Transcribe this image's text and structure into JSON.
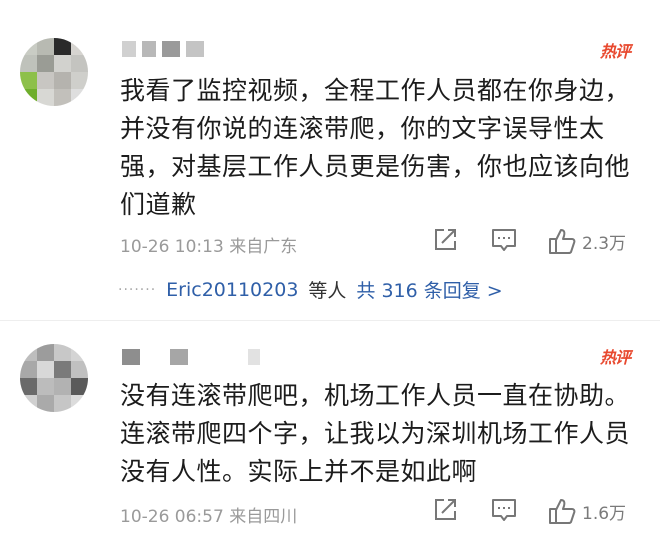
{
  "comments": [
    {
      "hot_badge": "热评",
      "text_lines": [
        "我看了监控视频，全程工作人员都在你身边，",
        "并没有你说的连滚带爬，你的文字误导性太",
        "强，对基层工作人员更是伤害，你也应该向他",
        "们道歉"
      ],
      "timestamp": "10-26 10:13",
      "location": "来自广东",
      "likes": "2.3万",
      "replies": {
        "dots": "·······",
        "user": "Eric20110203",
        "suffix": "等人",
        "count_text": "共 316 条回复 >"
      }
    },
    {
      "hot_badge": "热评",
      "text_lines": [
        "没有连滚带爬吧，机场工作人员一直在协助。",
        "连滚带爬四个字，让我以为深圳机场工作人员",
        "没有人性。实际上并不是如此啊"
      ],
      "timestamp": "10-26 06:57",
      "location": "来自四川",
      "likes": "1.6万"
    }
  ],
  "colors": {
    "hot_badge": "#e8492f",
    "reply_link": "#2f5fa8",
    "meta_gray": "#9a9a9a"
  },
  "icons": [
    "share-icon",
    "comment-icon",
    "thumbs-up-icon"
  ]
}
